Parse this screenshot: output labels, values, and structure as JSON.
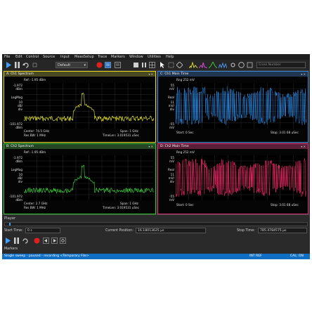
{
  "menu": [
    "File",
    "Edit",
    "Control",
    "Source",
    "Input",
    "MeasSetup",
    "Trace",
    "Markers",
    "Window",
    "Utilities",
    "Help"
  ],
  "toolbar": {
    "preset": "Default",
    "search_placeholder": "Cross Number"
  },
  "panels": {
    "a": {
      "title": "A: Ch1 Spectrum",
      "ref": "Ref: -1.95 dBm",
      "top_scale": "-1.972\ndBm",
      "mid_scale": "LogMag",
      "mid_scale2": "10\ndB/\ndiv",
      "bottom_scale": "-101.972\ndBm",
      "center": "Center: 74.5 GHz",
      "rbw": "Res BW: 1 MHz",
      "span": "Span: 1 GHz",
      "timelen": "TimeLen: 3.019531 uSec",
      "color": "#f3f32a"
    },
    "b": {
      "title": "B: Ch2 Spectrum",
      "ref": "Ref: -1.95 dBm",
      "top_scale": "-1.972\ndBm",
      "mid_scale": "LogMag",
      "mid_scale2": "10\ndB/\ndiv",
      "bottom_scale": "-101.972\ndBm",
      "center": "Center: 2.7 GHz",
      "rbw": "Res BW: 1 MHz",
      "span": "Span: 1 GHz",
      "timelen": "TimeLen: 3.019531 uSec",
      "color": "#3de03d"
    },
    "c": {
      "title": "C: Ch1 Main Time",
      "ref": "Rng 252 mV",
      "top_scale": "55\nmV",
      "mid_scale": "Real",
      "mid_scale2": "11\nmV/\ndiv",
      "bottom_scale": "-55\nmV",
      "start": "Start: 0   Sec",
      "stop": "Stop: 3.01 68 uSec",
      "color": "#2f8de8"
    },
    "d": {
      "title": "D: Ch2 Main Time",
      "ref": "Rng 252 mV",
      "top_scale": "55\nmV",
      "mid_scale": "Real",
      "mid_scale2": "11\nmV/\ndiv",
      "bottom_scale": "-55\nmV",
      "start": "Start: 0   Sec",
      "stop": "Stop: 3.01 68 uSec",
      "color": "#ff2d6e"
    }
  },
  "player": {
    "title": "Player",
    "start_time_label": "Start Time:",
    "start_time_value": "0 s",
    "current_position_label": "Current Position:",
    "current_position_value": "16.18013625 µs",
    "stop_time_label": "Stop Time:",
    "stop_time_value": "785.4784575 µs",
    "markers_label": "Markers"
  },
  "status": {
    "left": "Single sweep - paused - recording <Temporary File>",
    "mid": "INT REF",
    "right": "CAL: ON"
  },
  "colors": {
    "panel_a_border": "#e6d61c",
    "panel_b_border": "#31c431",
    "panel_c_border": "#3a86d8",
    "panel_d_border": "#e0307a",
    "status_bar": "#0f6fc5"
  },
  "icons": [
    "play-icon",
    "pause-icon",
    "loop-icon",
    "record-icon",
    "stop-icon",
    "cursor-icon",
    "zoom-icon",
    "marker-icon",
    "spectrum-icon"
  ]
}
